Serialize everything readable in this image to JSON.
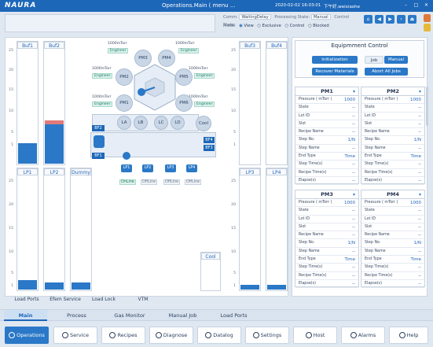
{
  "topbar": {
    "logo": "NAURA",
    "title": "Operations.Main  ( menu ...",
    "datetime": "2020-02-02  16:03:01",
    "user": "下午好,weixiaohe"
  },
  "status": {
    "comm_label": "Comm:",
    "comm_value": "WaitingDelay",
    "proc_label": "Processing State:",
    "proc_value": "Manual",
    "ctrl_label": "Control State:",
    "model_label": "Model",
    "opt_view": "View",
    "opt_exclusive": "Exclusive",
    "opt_control": "Control",
    "opt_blocked": "Blocked"
  },
  "towers": {
    "buf1": "Buf1",
    "buf2": "Buf2",
    "buf3": "Buf3",
    "buf4": "Buf4",
    "lp1": "LP1",
    "lp2": "LP2",
    "dummy": "Dummy",
    "lp3": "LP3",
    "lp4": "LP4",
    "ticks_top": [
      "25",
      "20",
      "15",
      "10",
      "5",
      "1"
    ],
    "ticks_bottom": [
      "25",
      "20",
      "15",
      "10",
      "5",
      "1"
    ]
  },
  "chamber": {
    "pm1": "PM1",
    "pm2": "PM2",
    "pm3": "PM3",
    "pm4": "PM4",
    "pm5": "PM5",
    "pm6": "PM6",
    "la": "LA",
    "lb": "LB",
    "lc": "LC",
    "ld": "LD",
    "cool": "Cool",
    "cool2": "Cool",
    "pressure": "1000mTorr",
    "engineer": "Engineer",
    "bf1": "BF1",
    "bf2": "BF2",
    "bf3": "BF3",
    "bf4": "BF4",
    "lp1": "LP1",
    "lp2": "LP2",
    "lp3": "LP3",
    "lp4": "LP4",
    "st1": "OnLine",
    "st2": "OffLine",
    "st3": "OffLine",
    "st4": "OffLine"
  },
  "equipment": {
    "title": "Equipmment Control",
    "initialization": "Initialization",
    "job": "Job",
    "manual": "Manual",
    "recover": "Recover Materials",
    "abort": "Abort All Jobs"
  },
  "pm_cards": [
    {
      "name": "PM1",
      "pressure": "1000"
    },
    {
      "name": "PM2",
      "pressure": "1000"
    },
    {
      "name": "PM3",
      "pressure": "1000"
    },
    {
      "name": "PM4",
      "pressure": "1000"
    }
  ],
  "pm_rows": {
    "pressure": "Pressure  ( mTorr )",
    "state": "State",
    "lot": "Lot ID",
    "slot": "Slot",
    "recipe": "Recipe Name",
    "stepno": "Step No.",
    "stepname": "Step Name",
    "endtype": "End Type",
    "steptime": "Step Time(s)",
    "recipetime": "Recipe Time(s)",
    "elapse": "Elapse(s)",
    "dash": "--",
    "stepno_val": "1/N",
    "endtype_val": "Time"
  },
  "subtabs": [
    "Load Ports",
    "Efem Service",
    "Load Lock",
    "VTM"
  ],
  "maintabs": [
    "Main",
    "Process",
    "Gas Monitor",
    "Manual Job",
    "Load Ports"
  ],
  "bottom": [
    "Operations",
    "Service",
    "Recipes",
    "Diagnose",
    "Datalog",
    "Settings",
    "Host",
    "Alarms",
    "Help"
  ],
  "colors": {
    "accent": "#1d67b8",
    "fill": "#2a78c7",
    "alert": "#e07a7a"
  }
}
